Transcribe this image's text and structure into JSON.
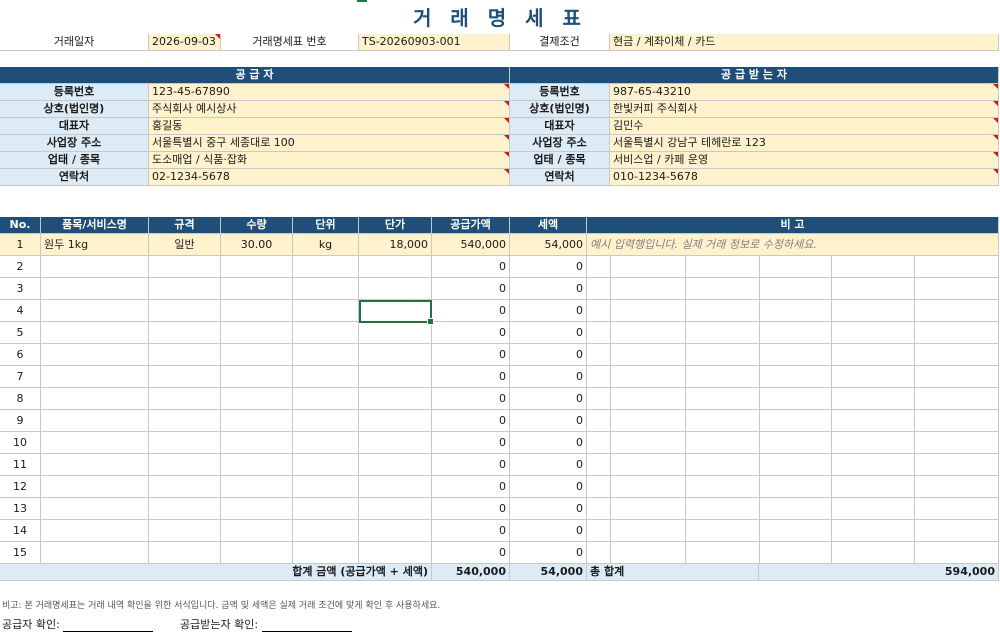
{
  "title": "거 래 명 세 표",
  "header": {
    "date_label": "거래일자",
    "date_value": "2026-09-03",
    "number_label": "거래명세표 번호",
    "number_value": "TS-20260903-001",
    "terms_label": "결제조건",
    "terms_value": "현금 / 계좌이체 / 카드"
  },
  "supplier": {
    "title": "공 급 자",
    "rows": [
      {
        "label": "등록번호",
        "value": "123-45-67890"
      },
      {
        "label": "상호(법인명)",
        "value": "주식회사 예시상사"
      },
      {
        "label": "대표자",
        "value": "홍길동"
      },
      {
        "label": "사업장 주소",
        "value": "서울특별시 중구 세종대로 100"
      },
      {
        "label": "업태 / 종목",
        "value": "도소매업 / 식품·잡화"
      },
      {
        "label": "연락처",
        "value": "02-1234-5678"
      }
    ]
  },
  "receiver": {
    "title": "공 급 받 는 자",
    "rows": [
      {
        "label": "등록번호",
        "value": "987-65-43210"
      },
      {
        "label": "상호(법인명)",
        "value": "한빛커피 주식회사"
      },
      {
        "label": "대표자",
        "value": "김민수"
      },
      {
        "label": "사업장 주소",
        "value": "서울특별시 강남구 테헤란로 123"
      },
      {
        "label": "업태 / 종목",
        "value": "서비스업 / 카페 운영"
      },
      {
        "label": "연락처",
        "value": "010-1234-5678"
      }
    ]
  },
  "items_header": [
    "No.",
    "품목/서비스명",
    "규격",
    "수량",
    "단위",
    "단가",
    "공급가액",
    "세액",
    "비 고"
  ],
  "items": [
    {
      "no": "1",
      "name": "원두 1kg",
      "spec": "일반",
      "qty": "30.00",
      "unit": "kg",
      "price": "18,000",
      "supply": "540,000",
      "tax": "54,000",
      "note": "예시 입력행입니다. 실제 거래 정보로 수정하세요."
    },
    {
      "no": "2",
      "name": "",
      "spec": "",
      "qty": "",
      "unit": "",
      "price": "",
      "supply": "0",
      "tax": "0",
      "note": ""
    },
    {
      "no": "3",
      "name": "",
      "spec": "",
      "qty": "",
      "unit": "",
      "price": "",
      "supply": "0",
      "tax": "0",
      "note": ""
    },
    {
      "no": "4",
      "name": "",
      "spec": "",
      "qty": "",
      "unit": "",
      "price": "",
      "supply": "0",
      "tax": "0",
      "note": ""
    },
    {
      "no": "5",
      "name": "",
      "spec": "",
      "qty": "",
      "unit": "",
      "price": "",
      "supply": "0",
      "tax": "0",
      "note": ""
    },
    {
      "no": "6",
      "name": "",
      "spec": "",
      "qty": "",
      "unit": "",
      "price": "",
      "supply": "0",
      "tax": "0",
      "note": ""
    },
    {
      "no": "7",
      "name": "",
      "spec": "",
      "qty": "",
      "unit": "",
      "price": "",
      "supply": "0",
      "tax": "0",
      "note": ""
    },
    {
      "no": "8",
      "name": "",
      "spec": "",
      "qty": "",
      "unit": "",
      "price": "",
      "supply": "0",
      "tax": "0",
      "note": ""
    },
    {
      "no": "9",
      "name": "",
      "spec": "",
      "qty": "",
      "unit": "",
      "price": "",
      "supply": "0",
      "tax": "0",
      "note": ""
    },
    {
      "no": "10",
      "name": "",
      "spec": "",
      "qty": "",
      "unit": "",
      "price": "",
      "supply": "0",
      "tax": "0",
      "note": ""
    },
    {
      "no": "11",
      "name": "",
      "spec": "",
      "qty": "",
      "unit": "",
      "price": "",
      "supply": "0",
      "tax": "0",
      "note": ""
    },
    {
      "no": "12",
      "name": "",
      "spec": "",
      "qty": "",
      "unit": "",
      "price": "",
      "supply": "0",
      "tax": "0",
      "note": ""
    },
    {
      "no": "13",
      "name": "",
      "spec": "",
      "qty": "",
      "unit": "",
      "price": "",
      "supply": "0",
      "tax": "0",
      "note": ""
    },
    {
      "no": "14",
      "name": "",
      "spec": "",
      "qty": "",
      "unit": "",
      "price": "",
      "supply": "0",
      "tax": "0",
      "note": ""
    },
    {
      "no": "15",
      "name": "",
      "spec": "",
      "qty": "",
      "unit": "",
      "price": "",
      "supply": "0",
      "tax": "0",
      "note": ""
    }
  ],
  "totals": {
    "label": "합계 금액 (공급가액 + 세액)",
    "supply": "540,000",
    "tax": "54,000",
    "grand_label": "총 합계",
    "grand_value": "594,000"
  },
  "footnote": "비고: 본 거래명세표는 거래 내역 확인을 위한 서식입니다. 금액 및 세액은 실제 거래 조건에 맞게 확인 후 사용하세요.",
  "sign": {
    "supplier_label": "공급자 확인:",
    "receiver_label": "공급받는자 확인:"
  },
  "colors": {
    "header_blue": "#1f4e79",
    "label_blue": "#ddebf7",
    "input_yellow": "#fff2cc",
    "selection_green": "#217346"
  }
}
